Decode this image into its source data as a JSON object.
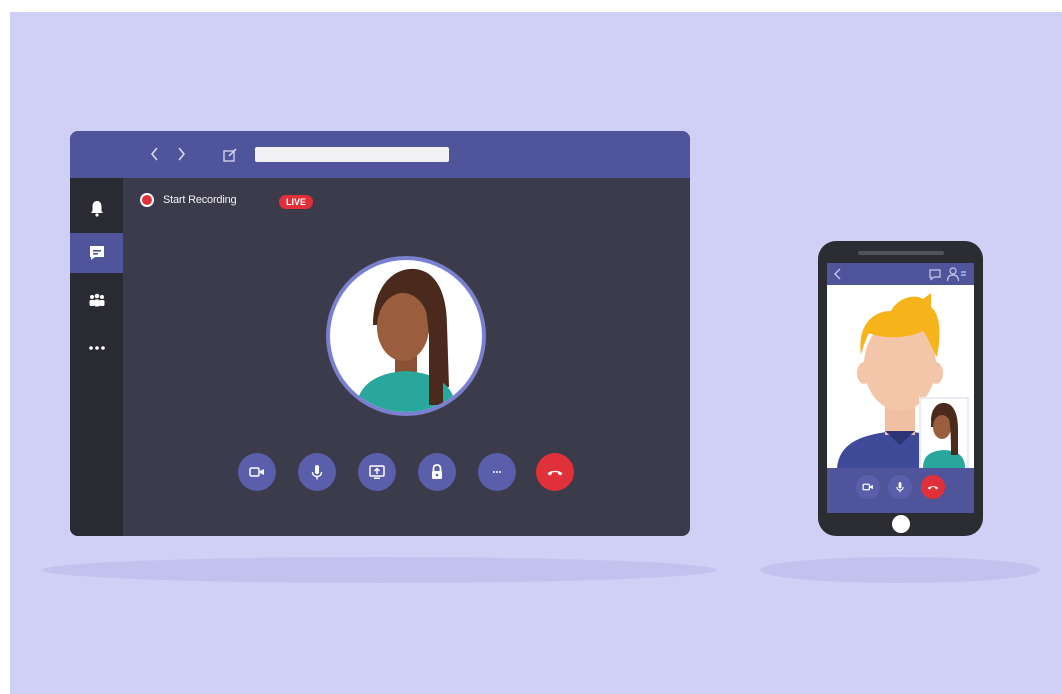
{
  "window": {
    "recording_label": "Start Recording",
    "live_badge": "LIVE",
    "sidebar_icons": [
      "bell-icon",
      "chat-icon",
      "teams-icon",
      "more-icon"
    ],
    "controls": [
      "video-camera-icon",
      "microphone-icon",
      "share-screen-icon",
      "lock-icon",
      "more-options-icon",
      "end-call-icon"
    ]
  },
  "phone": {
    "header_icons": [
      "back-icon",
      "chat-bubble-icon",
      "add-participant-icon"
    ],
    "controls": [
      "video-camera-icon",
      "microphone-icon",
      "end-call-icon"
    ]
  },
  "colors": {
    "background": "#d0cff6",
    "titlebar": "#4f549b",
    "window_body": "#3c3b4b",
    "sidebar": "#2a2a33",
    "control_button": "#5b5fab",
    "end_call": "#e0313b"
  }
}
